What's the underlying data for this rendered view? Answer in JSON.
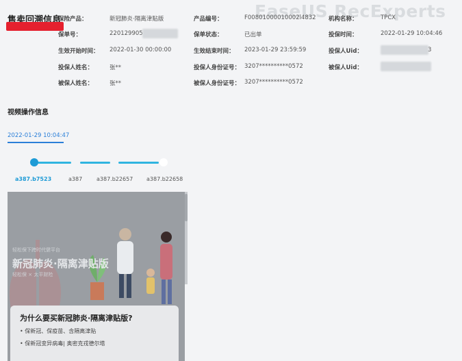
{
  "watermark": "EaseUS RecExperts",
  "header": {
    "title": "售卖回溯信息"
  },
  "fields": {
    "product_label": "保险产品：",
    "product_value": "新冠肺炎·隔离津贴版",
    "product_no_label": "产品编号：",
    "product_no_value": "F00801000010002l4832",
    "org_label": "机构名称：",
    "org_value": "TPCX",
    "policy_no_label": "保单号：",
    "policy_no_value": "220129905",
    "policy_status_label": "保单状态：",
    "policy_status_value": "已出单",
    "insure_time_label": "投保时间：",
    "insure_time_value": "2022-01-29 10:04:46",
    "start_label": "生效开始时间：",
    "start_value": "2022-01-30 00:00:00",
    "end_label": "生效结束时间：",
    "end_value": "2023-01-29 23:59:59",
    "holder_uid_label": "投保人Uid：",
    "holder_uid_value": "3",
    "holder_name_label": "投保人姓名：",
    "holder_name_value": "张**",
    "holder_id_label": "投保人身份证号：",
    "holder_id_value": "3207**********0572",
    "insured_uid_label": "被保人Uid：",
    "insured_name_label": "被保人姓名：",
    "insured_name_value": "张**",
    "insured_id_label": "被保人身份证号：",
    "insured_id_value": "3207**********0572"
  },
  "video_section": {
    "title": "视频操作信息",
    "date_tab": "2022-01-29 10:04:47",
    "steps": [
      "a387.b7523",
      "a387",
      "a387.b22657",
      "a387.b22658"
    ],
    "active_step": 0
  },
  "video": {
    "caption_small": "轻松保下跨时代健平台",
    "caption_big": "新冠肺炎·隔离津贴版",
    "caption_brand": "轻松保 × 太平财险",
    "card_title": "为什么要买新冠肺炎·隔离津贴版?",
    "bullet1": "• 保新冠、保疫苗、含隔离津贴",
    "bullet2": "• 保新冠变异病毒| 奥密克戎德尔塔"
  },
  "colors": {
    "accent": "#2b7fd8",
    "track": "#2fb4e0",
    "redaction": "#e5202e"
  }
}
